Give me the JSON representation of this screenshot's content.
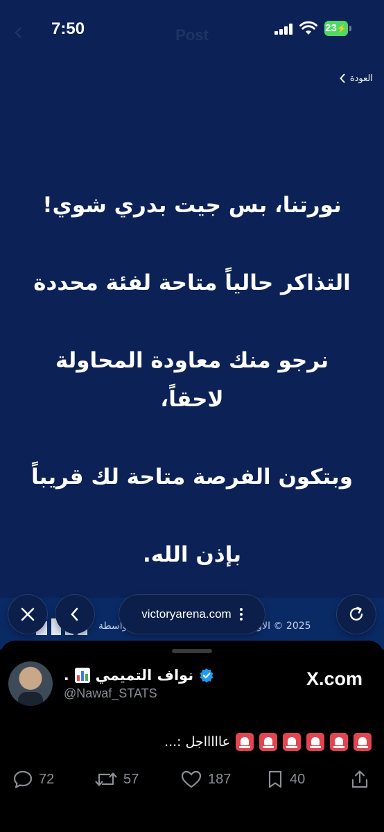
{
  "status_bar": {
    "time": "7:50",
    "battery": "23"
  },
  "nav": {
    "ghost_title": "Post"
  },
  "page": {
    "back_label": "العودة",
    "message_lines": [
      "نورتنا، بس جيت بدري شوي!",
      "التذاكر حالياً متاحة لفئة محددة",
      "نرجو منك معاودة المحاولة لاحقاً،",
      "وبتكون الفرصة متاحة لك قريباً",
      "بإذن الله."
    ],
    "footer_text": "2025 © الأول بارك. جميع الحقوق محفوظة بواسطة"
  },
  "browser": {
    "url": "victoryarena.com",
    "close_icon": "close-icon",
    "back_icon": "chevron-left-icon",
    "reload_icon": "reload-icon"
  },
  "tweet": {
    "author_name": "نواف التميمي",
    "author_handle": "@Nawaf_STATS",
    "source": "X.com",
    "text": "عاااااجل :...",
    "siren_count": 6,
    "replies": "72",
    "retweets": "57",
    "likes": "187",
    "bookmarks": "40"
  },
  "colors": {
    "page_bg": "#0c2257",
    "sheet_bg": "#000000",
    "verified": "#1d9bf0",
    "siren": "#e2454f",
    "muted": "#8b8f96"
  }
}
